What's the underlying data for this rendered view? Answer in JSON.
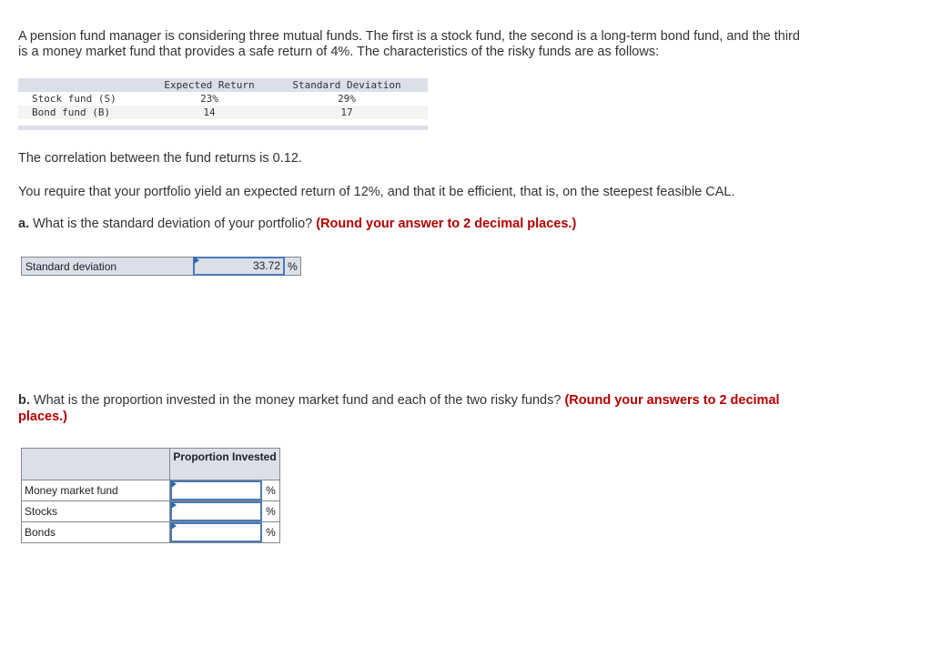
{
  "intro": {
    "line1": "A pension fund manager is considering three mutual funds. The first is a stock fund, the second is a long-term bond fund, and the third",
    "line2": "is a money market fund that provides a safe return of 4%. The characteristics of the risky funds are as follows:"
  },
  "fund_table": {
    "headers": [
      "",
      "Expected Return",
      "Standard Deviation"
    ],
    "rows": [
      {
        "name": "Stock fund (S)",
        "expected_return": "23%",
        "std_dev": "29%"
      },
      {
        "name": "Bond fund (B)",
        "expected_return": "14",
        "std_dev": "17"
      }
    ]
  },
  "correlation_text": "The correlation between the fund returns is 0.12.",
  "requirement_text": "You require that your portfolio yield an expected return of 12%, and that it be efficient, that is, on the steepest feasible CAL.",
  "part_a": {
    "prefix": "a.",
    "question": " What is the standard deviation of your portfolio? ",
    "instruction": "(Round your answer to 2 decimal places.)",
    "row_label": "Standard deviation",
    "value": "33.72",
    "unit": "%"
  },
  "part_b": {
    "prefix": "b.",
    "question": " What is the proportion invested in the money market fund and each of the two risky funds? ",
    "instruction_line1": "(Round your answers to 2 decimal",
    "instruction_line2": "places.)",
    "column_header": "Proportion Invested",
    "rows": [
      {
        "label": "Money market fund",
        "value": "",
        "unit": "%"
      },
      {
        "label": "Stocks",
        "value": "",
        "unit": "%"
      },
      {
        "label": "Bonds",
        "value": "",
        "unit": "%"
      }
    ]
  }
}
